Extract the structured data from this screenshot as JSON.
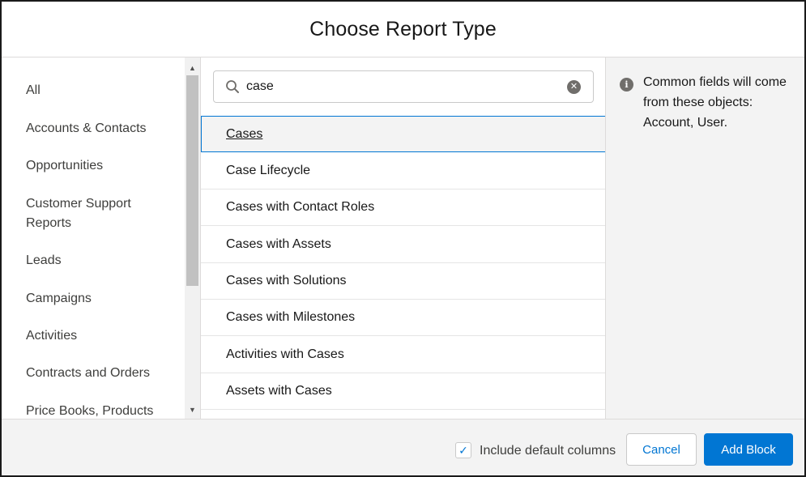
{
  "header": {
    "title": "Choose Report Type"
  },
  "categories": [
    "All",
    "Accounts & Contacts",
    "Opportunities",
    "Customer Support Reports",
    "Leads",
    "Campaigns",
    "Activities",
    "Contracts and Orders",
    "Price Books, Products"
  ],
  "search": {
    "value": "case",
    "placeholder": ""
  },
  "results": [
    "Cases",
    "Case Lifecycle",
    "Cases with Contact Roles",
    "Cases with Assets",
    "Cases with Solutions",
    "Cases with Milestones",
    "Activities with Cases",
    "Assets with Cases"
  ],
  "selected_result_index": 0,
  "info": {
    "text": "Common fields will come from these objects: Account, User."
  },
  "footer": {
    "include_default_columns_label": "Include default columns",
    "include_default_columns_checked": true,
    "cancel_label": "Cancel",
    "add_block_label": "Add Block"
  },
  "colors": {
    "accent": "#0176d3",
    "panel_bg": "#f3f3f3",
    "border": "#dddbda"
  },
  "icons": {
    "search": "search-icon",
    "clear": "clear-icon",
    "info": "info-icon",
    "check": "check-icon",
    "scroll_up": "chevron-up-icon",
    "scroll_down": "chevron-down-icon"
  }
}
